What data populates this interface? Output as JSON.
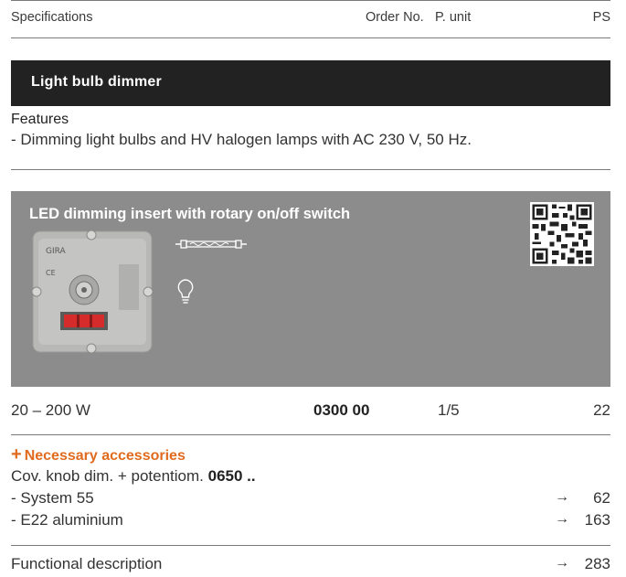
{
  "header": {
    "specifications": "Specifications",
    "order_no": "Order No.",
    "p_unit": "P. unit",
    "ps": "PS"
  },
  "section": {
    "title": "Light bulb dimmer"
  },
  "features": {
    "heading": "Features",
    "text": "- Dimming light bulbs and HV halogen lamps with AC 230 V, 50 Hz."
  },
  "product": {
    "title": "LED dimming insert with rotary on/off switch",
    "device_brand": "GIRA",
    "icons": [
      "halogen-tube-icon",
      "light-bulb-icon",
      "qr-code"
    ]
  },
  "spec_row": {
    "power": "20 – 200 W",
    "order_no": "0300 00",
    "p_unit": "1/5",
    "ps": "22"
  },
  "accessories": {
    "plus": "+",
    "heading": "Necessary accessories",
    "item_label": "Cov. knob dim. + potentiom.",
    "item_order": "0650 ..",
    "lines": [
      {
        "label": "- System 55",
        "arrow": "→",
        "page": "62"
      },
      {
        "label": "- E22 aluminium",
        "arrow": "→",
        "page": "163"
      }
    ]
  },
  "functional": {
    "label": "Functional description",
    "arrow": "→",
    "page": "283"
  },
  "colors": {
    "accent": "#e06b1f",
    "bar": "#222222",
    "panel": "#8c8c8c"
  }
}
